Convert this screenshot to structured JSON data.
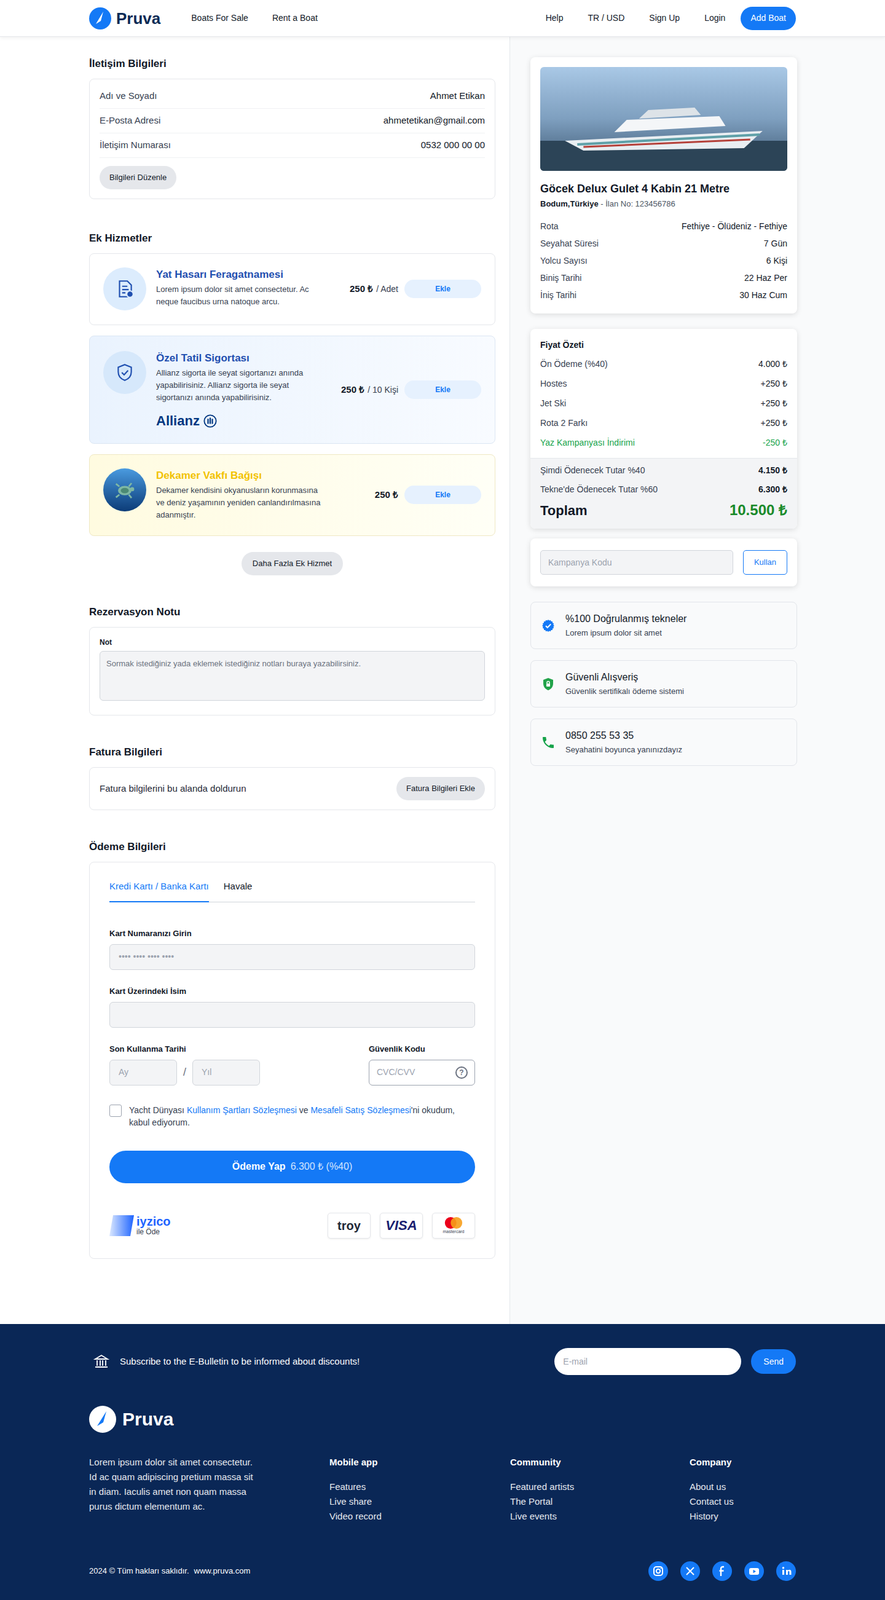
{
  "header": {
    "logo": "Pruva",
    "nav": [
      "Boats For Sale",
      "Rent a Boat"
    ],
    "right": [
      "Help",
      "TR / USD",
      "Sign Up",
      "Login"
    ],
    "cta": "Add Boat"
  },
  "contact": {
    "title": "İletişim Bilgileri",
    "rows": [
      {
        "label": "Adı ve Soyadı",
        "value": "Ahmet Etikan"
      },
      {
        "label": "E-Posta Adresi",
        "value": "ahmetetikan@gmail.com"
      },
      {
        "label": "İletişim Numarası",
        "value": "0532 000 00 00"
      }
    ],
    "button": "Bilgileri Düzenle"
  },
  "services": {
    "title": "Ek Hizmetler",
    "items": [
      {
        "kind": "waiver",
        "color": "#1f4fb0",
        "title": "Yat Hasarı Feragatnamesi",
        "desc": "Lorem ipsum dolor sit amet consectetur. Ac neque faucibus urna natoque arcu.",
        "price": "250 ₺",
        "unit": "/ Adet",
        "button": "Ekle"
      },
      {
        "kind": "insurance",
        "color": "#1f4fb0",
        "title": "Özel Tatil Sigortası",
        "desc": "Allianz sigorta ile seyat sigortanızı anında yapabilirisiniz. Allianz sigorta ile seyat sigortanızı anında yapabilirisiniz.",
        "brand": "Allianz",
        "price": "250 ₺",
        "unit": "/ 10 Kişi",
        "button": "Ekle"
      },
      {
        "kind": "donation",
        "color": "#f2c200",
        "title": "Dekamer Vakfı Bağışı",
        "desc": "Dekamer kendisini okyanusların korunmasına ve deniz yaşamının yeniden canlandırılmasına adanmıştır.",
        "price": "250 ₺",
        "button": "Ekle"
      }
    ],
    "more": "Daha Fazla Ek Hizmet"
  },
  "note": {
    "title": "Rezervasyon Notu",
    "label": "Not",
    "placeholder": "Sormak istediğiniz yada eklemek istediğiniz notları buraya yazabilirsiniz."
  },
  "invoice": {
    "title": "Fatura Bilgileri",
    "text": "Fatura bilgilerini bu alanda doldurun",
    "button": "Fatura Bilgileri Ekle"
  },
  "payment": {
    "title": "Ödeme Bilgileri",
    "tabs": [
      {
        "label": "Kredi Kartı / Banka Kartı",
        "selected": true
      },
      {
        "label": "Havale",
        "selected": false
      }
    ],
    "card_number": {
      "label": "Kart Numaranızı Girin",
      "placeholder": "•••• •••• •••• ••••"
    },
    "card_name": {
      "label": "Kart Üzerindeki İsim"
    },
    "expiry": {
      "label": "Son Kullanma Tarihi",
      "month": "Ay",
      "separator": "/",
      "year": "Yıl"
    },
    "cvc": {
      "label": "Güvenlik Kodu",
      "placeholder": "CVC/CVV",
      "help": "?"
    },
    "agreement": {
      "checked": false,
      "parts": [
        {
          "kind": "text",
          "text": "Yacht Dünyası "
        },
        {
          "kind": "link",
          "text": "Kullanım Şartları Sözleşmesi"
        },
        {
          "kind": "text",
          "text": " ve "
        },
        {
          "kind": "link",
          "text": "Mesafeli Satış Sözleşmesi"
        },
        {
          "kind": "text",
          "text": "'ni okudum, kabul ediyorum."
        }
      ]
    },
    "pay": {
      "label": "Ödeme Yap",
      "amount": "6.300 ₺ (%40)"
    },
    "iyzico": {
      "name": "iyzico",
      "sub": "ile Öde"
    },
    "cards": [
      {
        "kind": "troy",
        "text": "troy"
      },
      {
        "kind": "visa",
        "text": "VISA"
      },
      {
        "kind": "mastercard",
        "text": "mastercard"
      }
    ]
  },
  "boat": {
    "title": "Göcek Delux Gulet 4 Kabin 21 Metre",
    "location": "Bodum,Türkiye",
    "listing": "- İlan No: 123456786",
    "details": [
      {
        "label": "Rota",
        "value": "Fethiye - Ölüdeniz - Fethiye"
      },
      {
        "label": "Seyahat Süresi",
        "value": "7 Gün"
      },
      {
        "label": "Yolcu Sayısı",
        "value": "6 Kişi"
      },
      {
        "label": "Biniş Tarihi",
        "value": "22 Haz Per"
      },
      {
        "label": "İniş Tarihi",
        "value": "30 Haz Cum"
      }
    ]
  },
  "price": {
    "title": "Fiyat Özeti",
    "lines": [
      {
        "kind": "charge",
        "label": "Ön Ödeme (%40)",
        "value": "4.000 ₺"
      },
      {
        "kind": "charge",
        "label": "Hostes",
        "value": "+250 ₺"
      },
      {
        "kind": "charge",
        "label": "Jet Ski",
        "value": "+250 ₺"
      },
      {
        "kind": "charge",
        "label": "Rota 2 Farkı",
        "value": "+250 ₺"
      },
      {
        "kind": "discount",
        "label": "Yaz Kampanyası İndirimi",
        "value": "-250 ₺"
      }
    ],
    "payable": [
      {
        "label": "Şimdi Ödenecek Tutar %40",
        "value": "4.150 ₺"
      },
      {
        "label": "Tekne'de Ödenecek Tutar %60",
        "value": "6.300 ₺"
      }
    ],
    "total_label": "Toplam",
    "total": "10.500 ₺"
  },
  "coupon": {
    "placeholder": "Kampanya Kodu",
    "button": "Kullan"
  },
  "features": [
    {
      "kind": "verified",
      "title": "%100 Doğrulanmış tekneler",
      "text": "Lorem ipsum dolor sit amet"
    },
    {
      "kind": "secure",
      "title": "Güvenli Alışveriş",
      "text": "Güvenlik sertifikalı ödeme sistemi"
    },
    {
      "kind": "phone",
      "title": "0850 255 53 35",
      "text": "Seyahatini boyunca yanınızdayız"
    }
  ],
  "footer": {
    "newsletter": "Subscribe to the E-Bulletin to be informed about discounts!",
    "email_placeholder": "E-mail",
    "send": "Send",
    "logo": "Pruva",
    "about": "Lorem ipsum dolor sit amet consectetur. Id ac quam adipiscing pretium massa sit in diam. Iaculis amet non quam massa purus dictum elementum ac.",
    "columns": [
      {
        "title": "Mobile app",
        "links": [
          "Features",
          "Live share",
          "Video record"
        ]
      },
      {
        "title": "Community",
        "links": [
          "Featured artists",
          "The Portal",
          "Live events"
        ]
      },
      {
        "title": "Company",
        "links": [
          "About us",
          "Contact us",
          "History"
        ]
      }
    ],
    "copyright": "2024 © Tüm hakları saklıdır.",
    "site": "www.pruva.com",
    "social": [
      {
        "kind": "instagram"
      },
      {
        "kind": "x"
      },
      {
        "kind": "facebook"
      },
      {
        "kind": "youtube"
      },
      {
        "kind": "linkedin"
      }
    ]
  }
}
